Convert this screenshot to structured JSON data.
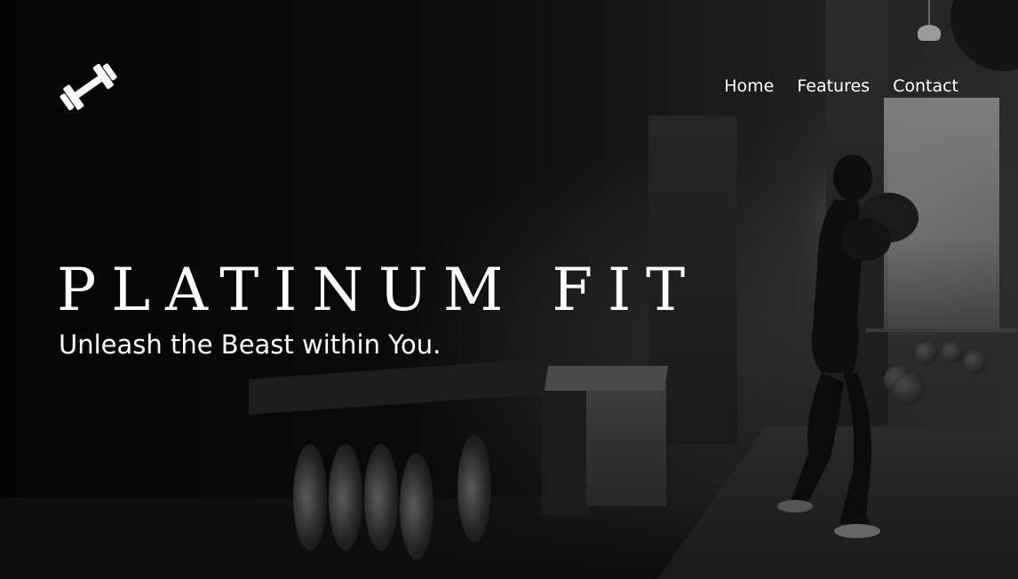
{
  "brand": {
    "logo_icon": "dumbbell-icon",
    "title": "PLATINUM FIT",
    "tagline": "Unleash the Beast within You."
  },
  "nav": {
    "items": [
      {
        "label": "Home"
      },
      {
        "label": "Features"
      },
      {
        "label": "Contact"
      }
    ]
  },
  "colors": {
    "text": "#ffffff",
    "background": "#050505"
  }
}
